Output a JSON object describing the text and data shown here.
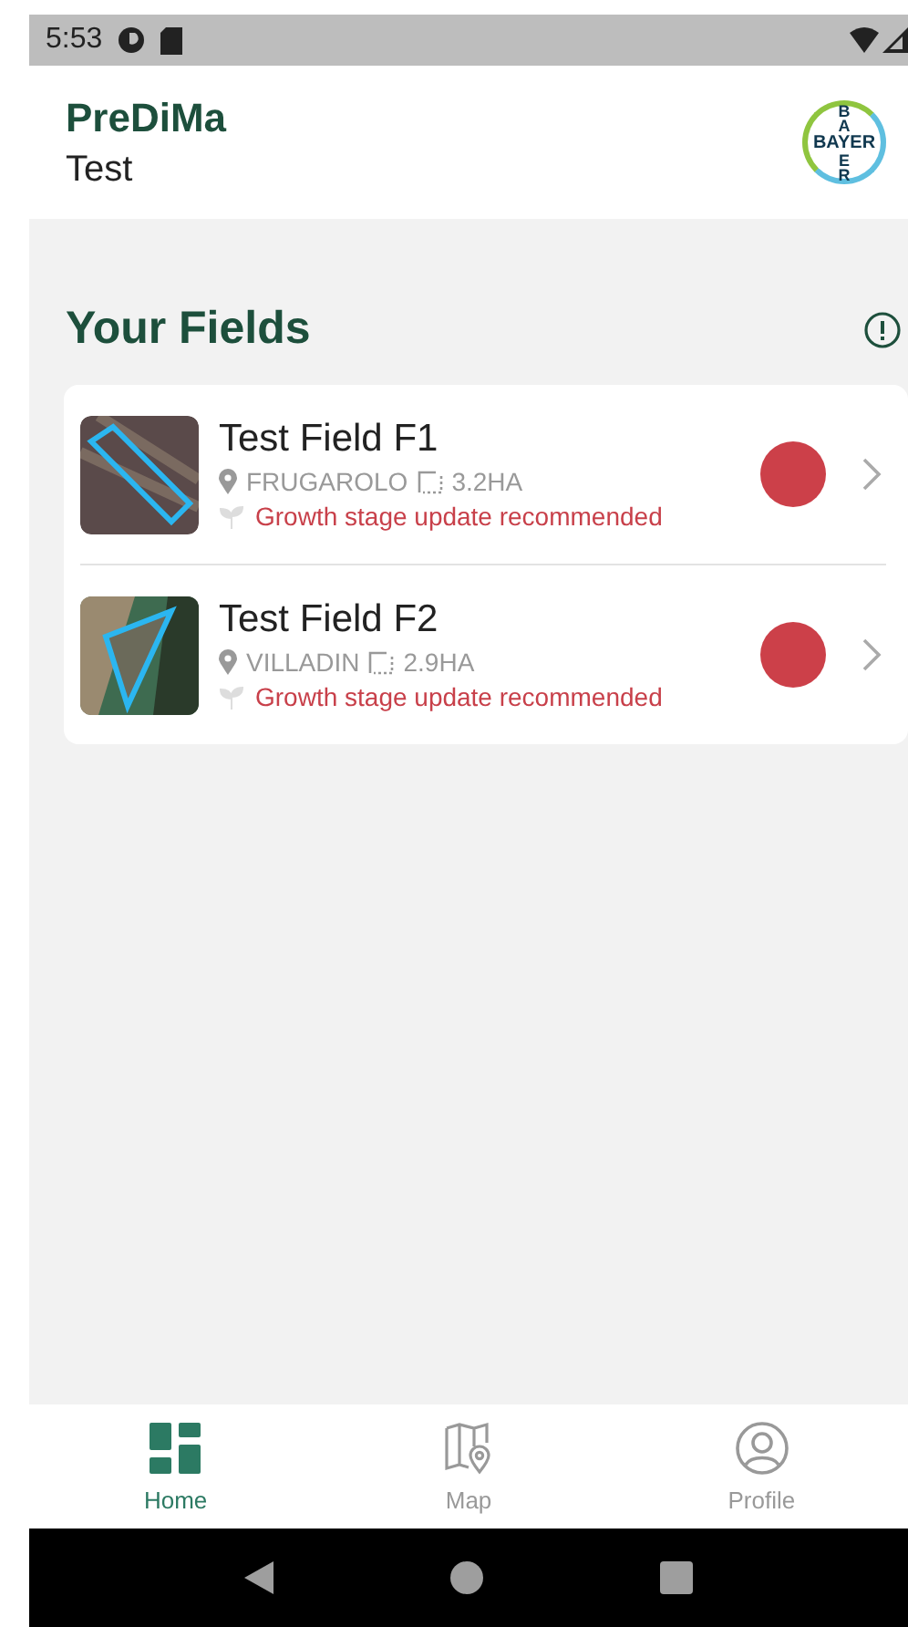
{
  "status_bar": {
    "time": "5:53"
  },
  "app_bar": {
    "title": "PreDiMa",
    "subtitle": "Test",
    "logo": {
      "horizontal": "BAYER",
      "vertical_top": "BA",
      "vertical_bottom": "ER"
    }
  },
  "section": {
    "title": "Your Fields"
  },
  "fields": [
    {
      "name": "Test Field F1",
      "location": "FRUGAROLO",
      "area": "3.2HA",
      "notice": "Growth stage update recommended",
      "color": "#cc4049",
      "kind": "strip"
    },
    {
      "name": "Test Field F2",
      "location": "VILLADIN",
      "area": "2.9HA",
      "notice": "Growth stage update recommended",
      "color": "#cc4049",
      "kind": "triangle"
    }
  ],
  "bottom_nav": [
    {
      "label": "Home",
      "kind": "home",
      "selected": true
    },
    {
      "label": "Map",
      "kind": "map",
      "selected": false
    },
    {
      "label": "Profile",
      "kind": "profile",
      "selected": false
    }
  ]
}
